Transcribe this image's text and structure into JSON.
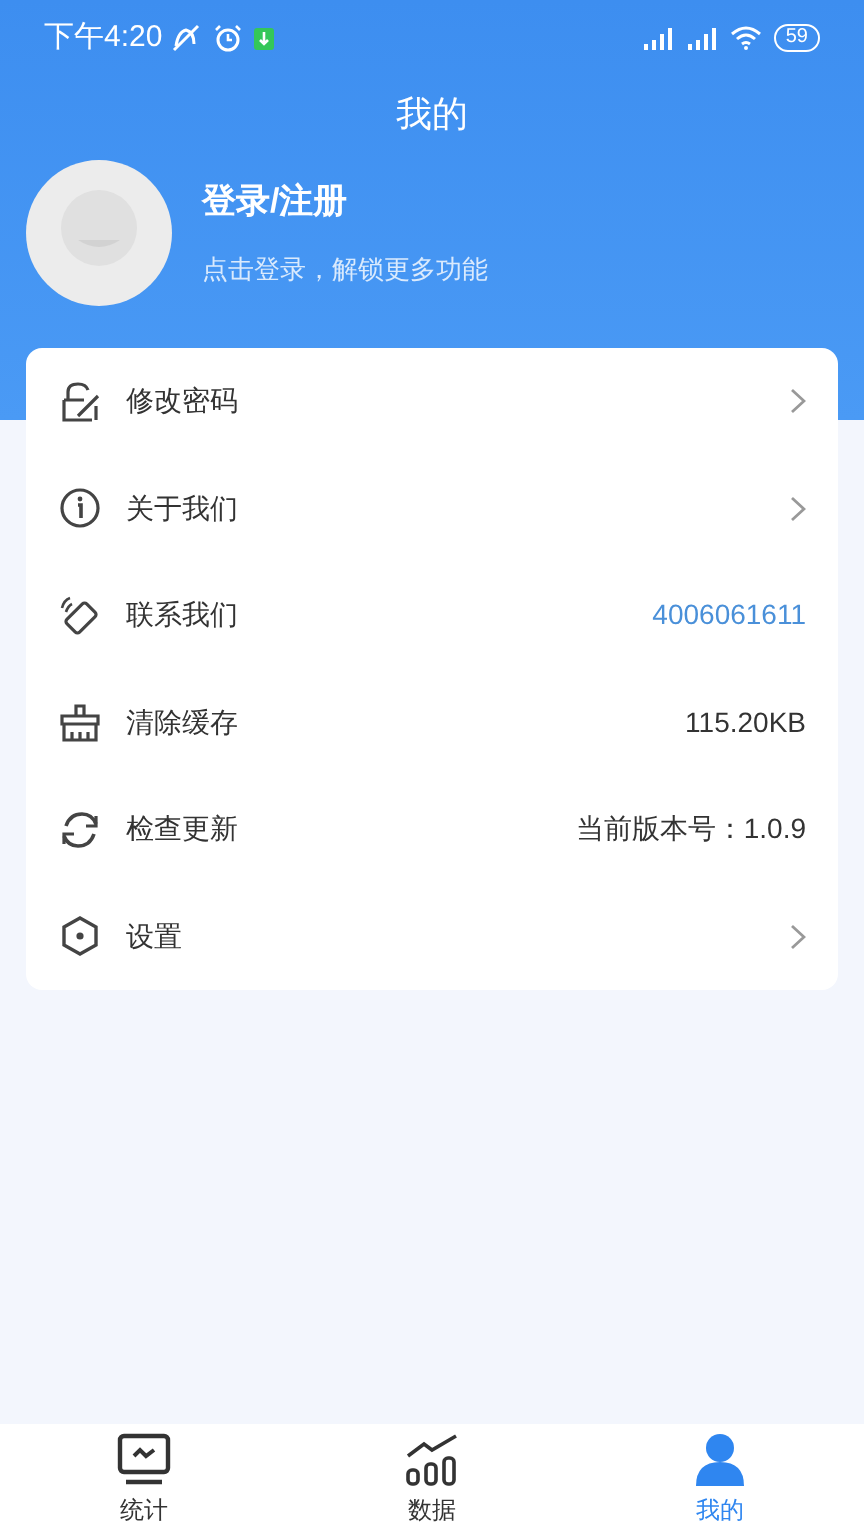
{
  "status_bar": {
    "time": "下午4:20",
    "battery": "59"
  },
  "header": {
    "title": "我的"
  },
  "profile": {
    "name": "登录/注册",
    "hint": "点击登录，解锁更多功能"
  },
  "menu": [
    {
      "label": "修改密码",
      "kind": "chevron"
    },
    {
      "label": "关于我们",
      "kind": "chevron"
    },
    {
      "label": "联系我们",
      "kind": "link",
      "value": "4006061611"
    },
    {
      "label": "清除缓存",
      "kind": "value",
      "value": "115.20KB"
    },
    {
      "label": "检查更新",
      "kind": "value",
      "value": "当前版本号：1.0.9"
    },
    {
      "label": "设置",
      "kind": "chevron"
    }
  ],
  "tabs": [
    {
      "label": "统计",
      "selected": false
    },
    {
      "label": "数据",
      "selected": false
    },
    {
      "label": "我的",
      "selected": true
    }
  ]
}
